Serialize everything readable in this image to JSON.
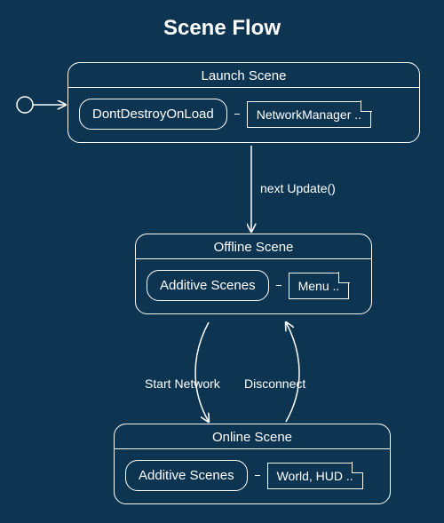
{
  "title": "Scene Flow",
  "launch": {
    "header": "Launch Scene",
    "bubble": "DontDestroyOnLoad",
    "note": "NetworkManager .."
  },
  "offline": {
    "header": "Offline Scene",
    "bubble": "Additive Scenes",
    "note": "Menu .."
  },
  "online": {
    "header": "Online Scene",
    "bubble": "Additive Scenes",
    "note": "World, HUD .."
  },
  "edges": {
    "launch_to_offline": "next Update()",
    "offline_to_online": "Start Network",
    "online_to_offline": "Disconnect"
  }
}
